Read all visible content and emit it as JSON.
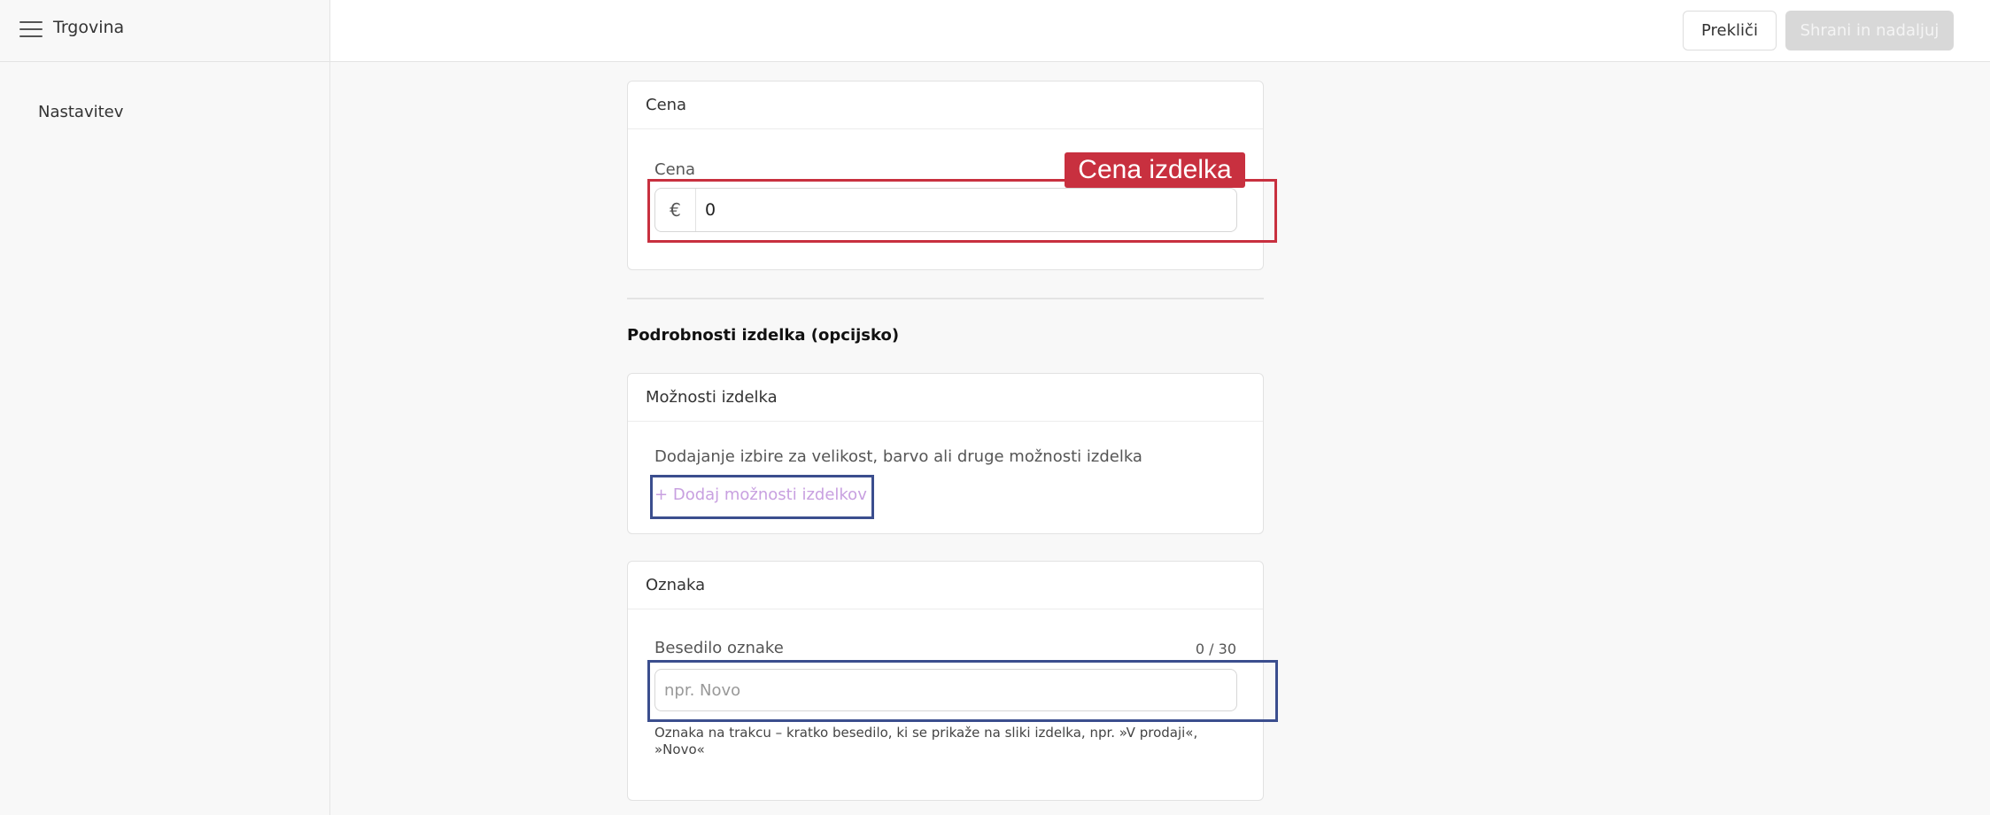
{
  "header": {
    "app_title": "Trgovina",
    "cancel_label": "Prekliči",
    "save_label": "Shrani in nadaljuj"
  },
  "sidebar": {
    "items": [
      {
        "label": "Nastavitev"
      }
    ]
  },
  "price_card": {
    "header": "Cena",
    "field_label": "Cena",
    "currency_symbol": "€",
    "value": "0",
    "annotation_tag": "Cena izdelka"
  },
  "details_section": {
    "title": "Podrobnosti izdelka (opcijsko)"
  },
  "options_card": {
    "header": "Možnosti izdelka",
    "description": "Dodajanje izbire za velikost, barvo ali druge možnosti izdelka",
    "add_icon": "plus-icon",
    "add_label": "Dodaj možnosti izdelkov"
  },
  "label_card": {
    "header": "Oznaka",
    "field_label": "Besedilo oznake",
    "counter": "0 / 30",
    "placeholder": "npr. Novo",
    "value": "",
    "help_text": "Oznaka na trakcu – kratko besedilo, ki se prikaže na sliki izdelka, npr. »V prodaji«, »Novo«"
  },
  "colors": {
    "annotation_red": "#c8303f",
    "annotation_blue": "#3b4e8e",
    "link_purple": "#c8a0e0",
    "disabled_button": "#d8d8d8"
  }
}
